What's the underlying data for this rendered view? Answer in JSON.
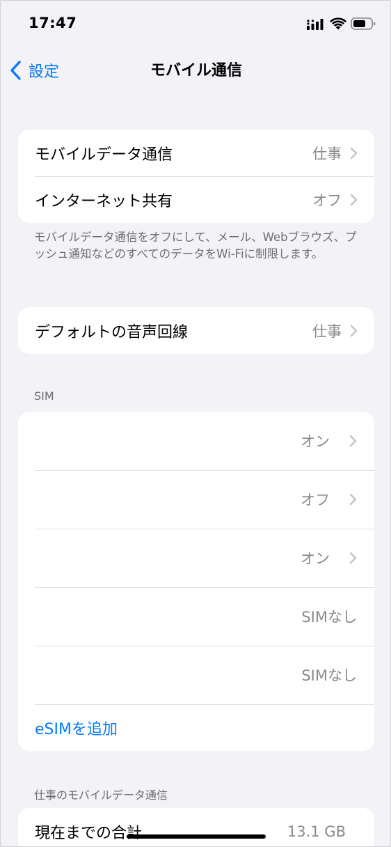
{
  "status_bar": {
    "time": "17:47",
    "signal_icon": "signal-bars-icon",
    "wifi_icon": "wifi-icon",
    "battery_icon": "battery-icon"
  },
  "nav": {
    "back_label": "設定",
    "title": "モバイル通信",
    "accent_color": "#0a7aff"
  },
  "group1": {
    "rows": [
      {
        "label": "モバイルデータ通信",
        "value": "仕事"
      },
      {
        "label": "インターネット共有",
        "value": "オフ"
      }
    ],
    "footer": "モバイルデータ通信をオフにして、メール、Webブラウズ、プッシュ通知などのすべてのデータをWi-Fiに制限します。"
  },
  "group2": {
    "rows": [
      {
        "label": "デフォルトの音声回線",
        "value": "仕事"
      }
    ]
  },
  "sim_section": {
    "header": "SIM",
    "rows": [
      {
        "value": "オン"
      },
      {
        "value": "オフ"
      },
      {
        "value": "オン"
      },
      {
        "value": "SIMなし"
      },
      {
        "value": "SIMなし"
      }
    ],
    "add_esim": "eSIMを追加"
  },
  "usage_section": {
    "header": "仕事のモバイルデータ通信",
    "rows": [
      {
        "label": "現在までの合計",
        "value": "13.1 GB"
      }
    ]
  }
}
